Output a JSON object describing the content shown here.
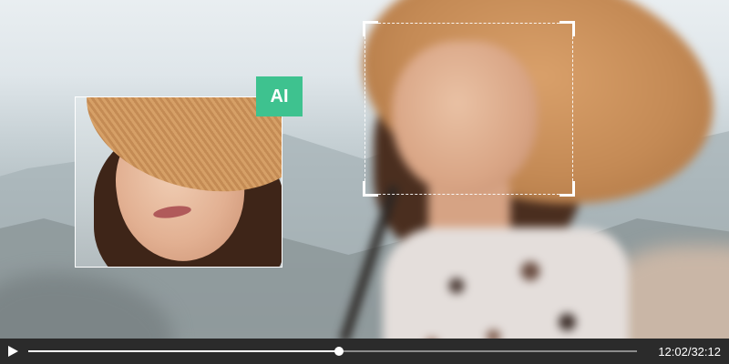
{
  "badge": {
    "label": "AI",
    "color": "#3ec28f"
  },
  "player": {
    "time_display": "12:02/32:12",
    "progress": 0.51,
    "play_icon": "play-icon"
  }
}
